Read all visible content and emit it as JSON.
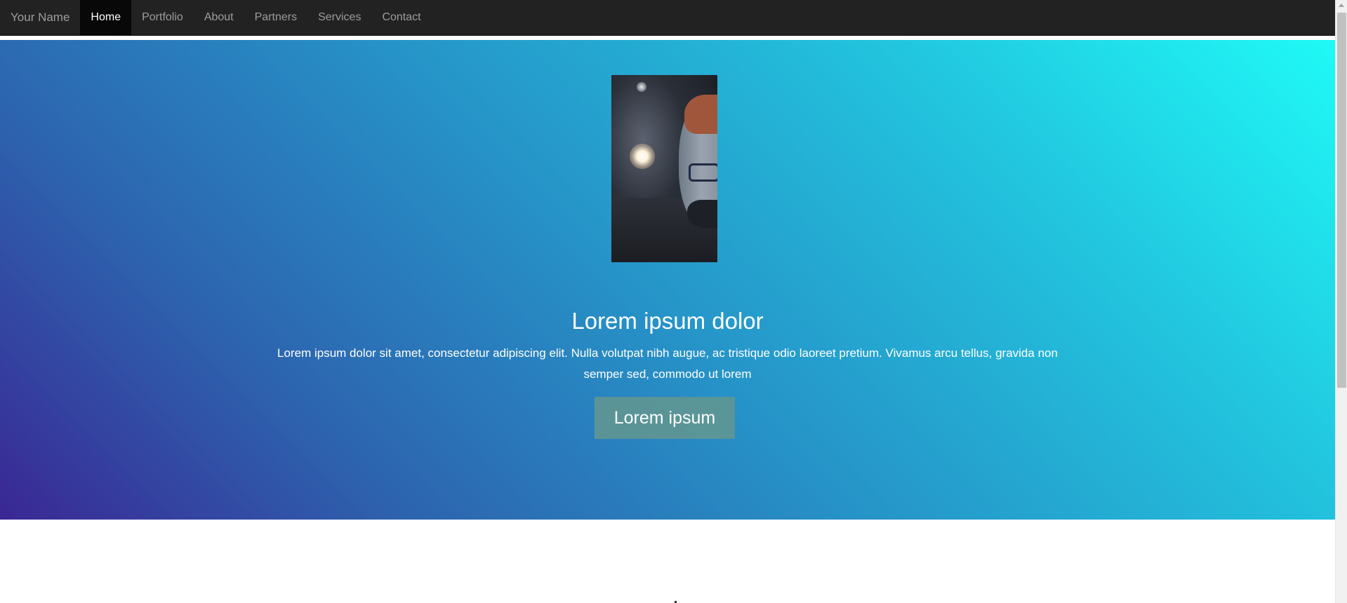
{
  "navbar": {
    "brand": "Your Name",
    "items": [
      {
        "label": "Home",
        "active": true
      },
      {
        "label": "Portfolio",
        "active": false
      },
      {
        "label": "About",
        "active": false
      },
      {
        "label": "Partners",
        "active": false
      },
      {
        "label": "Services",
        "active": false
      },
      {
        "label": "Contact",
        "active": false
      }
    ]
  },
  "hero": {
    "image": {
      "subject": "selfie-photo"
    },
    "title": "Lorem ipsum dolor",
    "text": "Lorem ipsum dolor sit amet, consectetur adipiscing elit. Nulla volutpat nibh augue, ac tristique odio laoreet pretium. Vivamus arcu tellus, gravida non semper sed, commodo ut lorem",
    "button_label": "Lorem ipsum",
    "gradient_colors": [
      "#3a2794",
      "#2d62ae",
      "#2694c8",
      "#22c4de",
      "#1ffaf6"
    ]
  },
  "colors": {
    "navbar_bg": "#222222",
    "nav_active_bg": "#080808",
    "nav_text": "#9d9d9d",
    "button_bg": "#609692"
  }
}
